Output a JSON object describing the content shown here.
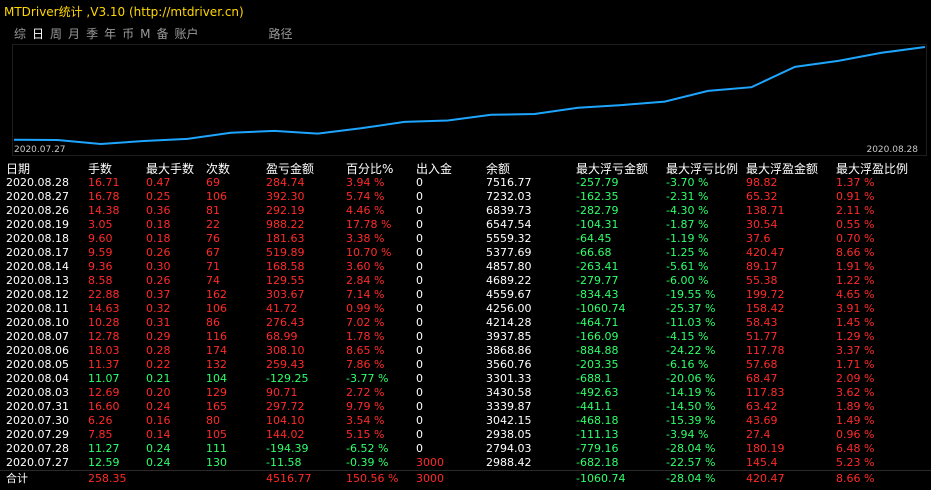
{
  "app": {
    "title": "MTDriver统计 ,V3.10 (http://mtdriver.cn)"
  },
  "tabs": [
    "综",
    "日",
    "周",
    "月",
    "季",
    "年",
    "币",
    "M",
    "备",
    "账户"
  ],
  "active_tab": "日",
  "path_label": "路径",
  "chart_dates": {
    "start": "2020.07.27",
    "end": "2020.08.28"
  },
  "columns": [
    "日期",
    "手数",
    "最大手数",
    "次数",
    "盈亏金额",
    "百分比%",
    "出入金",
    "余额",
    "最大浮亏金额",
    "最大浮亏比例",
    "最大浮盈金额",
    "最大浮盈比例"
  ],
  "rows": [
    [
      "2020.08.28",
      "16.71",
      "0.47",
      "69",
      "284.74",
      "3.94 %",
      "0",
      "7516.77",
      "-257.79",
      "-3.70 %",
      "98.82",
      "1.37 %"
    ],
    [
      "2020.08.27",
      "16.78",
      "0.25",
      "106",
      "392.30",
      "5.74 %",
      "0",
      "7232.03",
      "-162.35",
      "-2.31 %",
      "65.32",
      "0.91 %"
    ],
    [
      "2020.08.26",
      "14.38",
      "0.36",
      "81",
      "292.19",
      "4.46 %",
      "0",
      "6839.73",
      "-282.79",
      "-4.30 %",
      "138.71",
      "2.11 %"
    ],
    [
      "2020.08.19",
      "3.05",
      "0.18",
      "22",
      "988.22",
      "17.78 %",
      "0",
      "6547.54",
      "-104.31",
      "-1.87 %",
      "30.54",
      "0.55 %"
    ],
    [
      "2020.08.18",
      "9.60",
      "0.18",
      "76",
      "181.63",
      "3.38 %",
      "0",
      "5559.32",
      "-64.45",
      "-1.19 %",
      "37.6",
      "0.70 %"
    ],
    [
      "2020.08.17",
      "9.59",
      "0.26",
      "67",
      "519.89",
      "10.70 %",
      "0",
      "5377.69",
      "-66.68",
      "-1.25 %",
      "420.47",
      "8.66 %"
    ],
    [
      "2020.08.14",
      "9.36",
      "0.30",
      "71",
      "168.58",
      "3.60 %",
      "0",
      "4857.80",
      "-263.41",
      "-5.61 %",
      "89.17",
      "1.91 %"
    ],
    [
      "2020.08.13",
      "8.58",
      "0.26",
      "74",
      "129.55",
      "2.84 %",
      "0",
      "4689.22",
      "-279.77",
      "-6.00 %",
      "55.38",
      "1.22 %"
    ],
    [
      "2020.08.12",
      "22.88",
      "0.37",
      "162",
      "303.67",
      "7.14 %",
      "0",
      "4559.67",
      "-834.43",
      "-19.55 %",
      "199.72",
      "4.65 %"
    ],
    [
      "2020.08.11",
      "14.63",
      "0.32",
      "106",
      "41.72",
      "0.99 %",
      "0",
      "4256.00",
      "-1060.74",
      "-25.37 %",
      "158.42",
      "3.91 %"
    ],
    [
      "2020.08.10",
      "10.28",
      "0.31",
      "86",
      "276.43",
      "7.02 %",
      "0",
      "4214.28",
      "-464.71",
      "-11.03 %",
      "58.43",
      "1.45 %"
    ],
    [
      "2020.08.07",
      "12.78",
      "0.29",
      "116",
      "68.99",
      "1.78 %",
      "0",
      "3937.85",
      "-166.09",
      "-4.15 %",
      "51.77",
      "1.29 %"
    ],
    [
      "2020.08.06",
      "18.03",
      "0.28",
      "174",
      "308.10",
      "8.65 %",
      "0",
      "3868.86",
      "-884.88",
      "-24.22 %",
      "117.78",
      "3.37 %"
    ],
    [
      "2020.08.05",
      "11.37",
      "0.22",
      "132",
      "259.43",
      "7.86 %",
      "0",
      "3560.76",
      "-203.35",
      "-6.16 %",
      "57.68",
      "1.71 %"
    ],
    [
      "2020.08.04",
      "11.07",
      "0.21",
      "104",
      "-129.25",
      "-3.77 %",
      "0",
      "3301.33",
      "-688.1",
      "-20.06 %",
      "68.47",
      "2.09 %"
    ],
    [
      "2020.08.03",
      "12.69",
      "0.20",
      "129",
      "90.71",
      "2.72 %",
      "0",
      "3430.58",
      "-492.63",
      "-14.19 %",
      "117.83",
      "3.62 %"
    ],
    [
      "2020.07.31",
      "16.60",
      "0.24",
      "165",
      "297.72",
      "9.79 %",
      "0",
      "3339.87",
      "-441.1",
      "-14.50 %",
      "63.42",
      "1.89 %"
    ],
    [
      "2020.07.30",
      "6.26",
      "0.16",
      "80",
      "104.10",
      "3.54 %",
      "0",
      "3042.15",
      "-468.18",
      "-15.39 %",
      "43.69",
      "1.49 %"
    ],
    [
      "2020.07.29",
      "7.85",
      "0.14",
      "105",
      "144.02",
      "5.15 %",
      "0",
      "2938.05",
      "-111.13",
      "-3.94 %",
      "27.4",
      "0.96 %"
    ],
    [
      "2020.07.28",
      "11.27",
      "0.24",
      "111",
      "-194.39",
      "-6.52 %",
      "0",
      "2794.03",
      "-779.16",
      "-28.04 %",
      "180.19",
      "6.48 %"
    ],
    [
      "2020.07.27",
      "12.59",
      "0.24",
      "130",
      "-11.58",
      "-0.39 %",
      "3000",
      "2988.42",
      "-682.18",
      "-22.57 %",
      "145.4",
      "5.23 %"
    ]
  ],
  "total": {
    "label": "合计",
    "lots": "258.35",
    "pnl": "4516.77",
    "pct": "150.56 %",
    "deposit": "3000",
    "max_float_loss": "-1060.74",
    "max_float_loss_pct": "-28.04 %",
    "max_float_profit": "420.47",
    "max_float_profit_pct": "8.66 %"
  },
  "colors": {
    "profit": "#ff2a2a",
    "loss": "#2fff6a",
    "line": "#1ea5ff",
    "title": "#ffd700"
  }
}
